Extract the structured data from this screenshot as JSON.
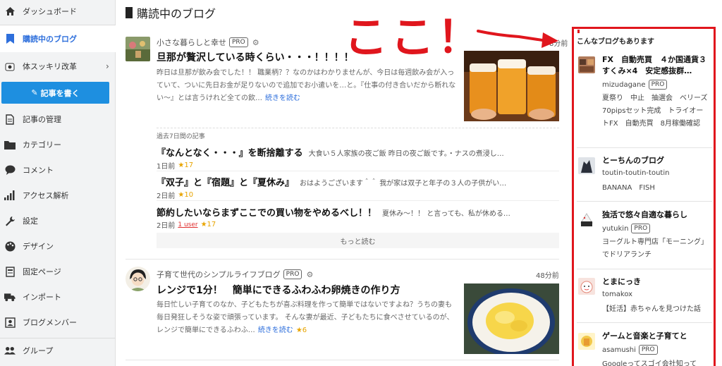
{
  "sidebar": {
    "items": [
      {
        "label": "ダッシュボード",
        "icon": "home-icon"
      },
      {
        "label": "購読中のブログ",
        "icon": "bookmark-icon"
      },
      {
        "label": "体スッキリ改革",
        "icon": "blog-icon"
      },
      {
        "label": "記事の管理",
        "icon": "document-icon"
      },
      {
        "label": "カテゴリー",
        "icon": "folder-icon"
      },
      {
        "label": "コメント",
        "icon": "comment-icon"
      },
      {
        "label": "アクセス解析",
        "icon": "bar-chart-icon"
      },
      {
        "label": "設定",
        "icon": "wrench-icon"
      },
      {
        "label": "デザイン",
        "icon": "palette-icon"
      },
      {
        "label": "固定ページ",
        "icon": "page-icon"
      },
      {
        "label": "インポート",
        "icon": "truck-icon"
      },
      {
        "label": "ブログメンバー",
        "icon": "member-icon"
      },
      {
        "label": "グループ",
        "icon": "group-icon"
      }
    ],
    "write_button": "記事を書く"
  },
  "main": {
    "title": "購読中のブログ",
    "post1": {
      "blog_name": "小さな暮らしと幸せ",
      "pro": "PRO",
      "time": "8分前",
      "title": "旦那が贅沢している時くらい・・・！！！！",
      "excerpt": "昨日は旦那が飲み会でした！！ 職業柄？？なのかはわかりませんが、今日は毎週飲み会が入っていて、ついに先日お金が足りないので追加でお小遣いを…と。『仕事の付き合いだから断れない〜』とは言うけれど全ての飲…",
      "more": "続きを読む"
    },
    "recent": {
      "label": "過去7日間の記事",
      "items": [
        {
          "title": "『なんとなく・・・』を断捨離する",
          "excerpt": "大食い５人家族の夜ご飯 昨日の夜ご飯です。・ナスの煮浸し…",
          "time": "1日前",
          "stars": "★17",
          "users": ""
        },
        {
          "title": "『双子』と『宿題』と『夏休み』",
          "excerpt": "おはようございます＾＾ 我が家は双子と年子の３人の子供がい…",
          "time": "2日前",
          "stars": "★10",
          "users": ""
        },
        {
          "title": "節約したいならまずここでの買い物をやめるべし！！",
          "excerpt": "夏休み〜！！ と言っても、私が休める…",
          "time": "2日前",
          "stars": "★17",
          "users": "1 user"
        }
      ],
      "more": "もっと読む"
    },
    "post2": {
      "blog_name": "子育て世代のシンプルライフブログ",
      "pro": "PRO",
      "time": "48分前",
      "title": "レンジで1分！　簡単にできるふわふわ卵焼きの作り方",
      "excerpt": "毎日忙しい子育てのなか、子どもたちが喜ぶ料理を作って簡単ではないですよね？うちの妻も毎日発狂しそうな姿で頑張っています。 そんな妻が最近、子どもたちに食べさせているのが、レンジで簡単にできるふわふ…",
      "more": "続きを読む",
      "stars": "★6"
    }
  },
  "recommend": {
    "heading": "こんなブログもあります",
    "items": [
      {
        "title": "FX　自動売買　４か国通貨３すくみ×4　安定感抜群…",
        "user": "mizudagane",
        "pro": "PRO",
        "tags": "夏祭り　中止　抽選会　ベリーズ　70pipsセット完成　トライオートFX　自動売買　8月稼働確認"
      },
      {
        "title": "とーちんのブログ",
        "user": "toutin-toutin-toutin",
        "pro": "",
        "tags": "BANANA　FISH"
      },
      {
        "title": "独活で悠々自適な暮らし",
        "user": "yutukin",
        "pro": "PRO",
        "tags": "ヨーグルト専門店「モーニング」でドリアランチ"
      },
      {
        "title": "とまにっき",
        "user": "tomakox",
        "pro": "",
        "tags": "【妊活】赤ちゃんを見つけた話"
      },
      {
        "title": "ゲームと音楽と子育てと",
        "user": "asamushi",
        "pro": "PRO",
        "tags": "Googleってスゴイ会社知って"
      }
    ]
  },
  "annotation": {
    "text": "ここ！"
  },
  "colors": {
    "accent": "#2e6fdc",
    "button": "#1e8fe0",
    "annotation_red": "#e0161d",
    "star": "#e8a400"
  }
}
